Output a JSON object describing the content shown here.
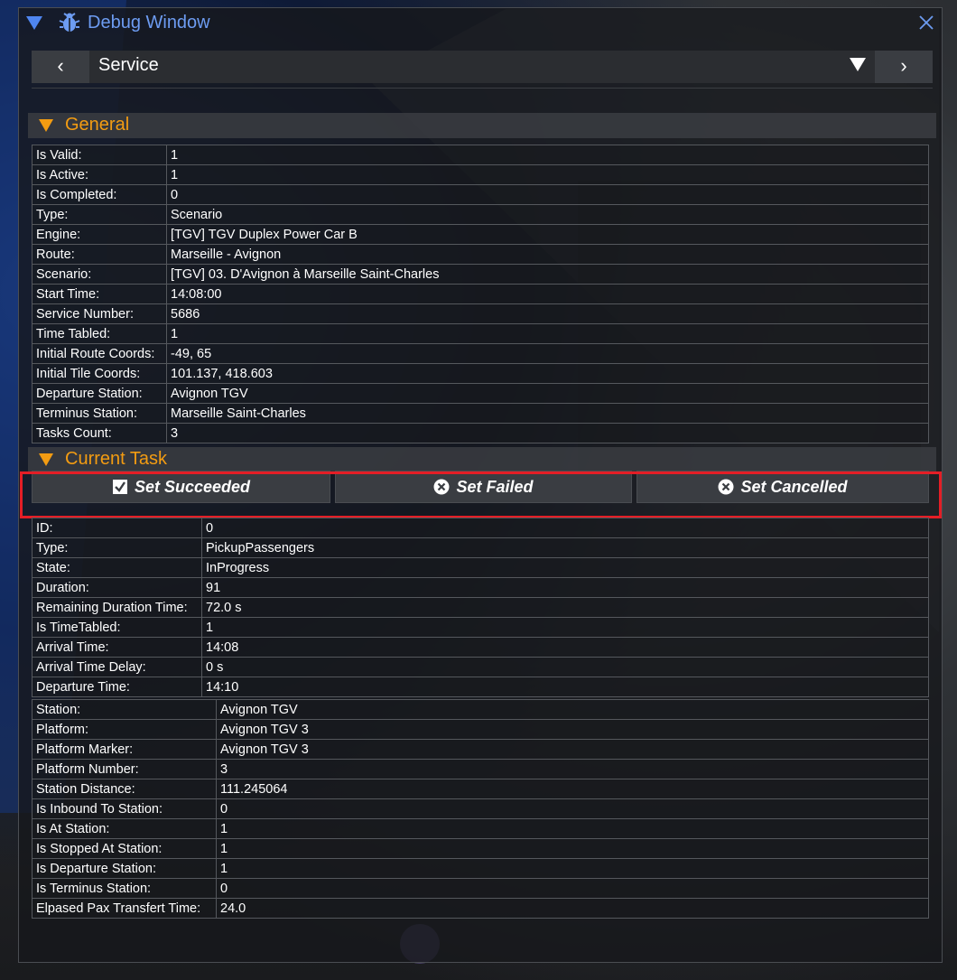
{
  "window": {
    "title": "Debug Window"
  },
  "nav": {
    "prev_label": "‹",
    "next_label": "›",
    "title": "Service"
  },
  "general": {
    "title": "General",
    "rows": [
      {
        "k": "Is Valid:",
        "v": "1"
      },
      {
        "k": "Is Active:",
        "v": "1"
      },
      {
        "k": "Is Completed:",
        "v": "0"
      },
      {
        "k": "Type:",
        "v": "Scenario"
      },
      {
        "k": "Engine:",
        "v": "[TGV] TGV Duplex Power Car B"
      },
      {
        "k": "Route:",
        "v": "Marseille - Avignon"
      },
      {
        "k": "Scenario:",
        "v": "[TGV] 03. D'Avignon à Marseille Saint-Charles"
      },
      {
        "k": "Start Time:",
        "v": "14:08:00"
      },
      {
        "k": "Service Number:",
        "v": "5686"
      },
      {
        "k": "Time Tabled:",
        "v": "1"
      },
      {
        "k": "Initial Route Coords:",
        "v": "-49, 65"
      },
      {
        "k": "Initial Tile Coords:",
        "v": "101.137, 418.603"
      },
      {
        "k": "Departure Station:",
        "v": "Avignon TGV"
      },
      {
        "k": "Terminus Station:",
        "v": "Marseille Saint-Charles"
      },
      {
        "k": "Tasks Count:",
        "v": "3"
      }
    ]
  },
  "current_task": {
    "title": "Current Task",
    "buttons": {
      "succeeded": "Set Succeeded",
      "failed": "Set Failed",
      "cancelled": "Set Cancelled"
    },
    "rows": [
      {
        "k": "ID:",
        "v": "0"
      },
      {
        "k": "Type:",
        "v": "PickupPassengers"
      },
      {
        "k": "State:",
        "v": "InProgress"
      },
      {
        "k": "Duration:",
        "v": "91"
      },
      {
        "k": "Remaining Duration Time:",
        "v": "72.0 s"
      },
      {
        "k": "Is TimeTabled:",
        "v": "1"
      },
      {
        "k": "Arrival Time:",
        "v": "14:08"
      },
      {
        "k": "Arrival Time Delay:",
        "v": "0 s"
      },
      {
        "k": "Departure Time:",
        "v": "14:10"
      }
    ],
    "station_rows": [
      {
        "k": "Station:",
        "v": "Avignon TGV"
      },
      {
        "k": "Platform:",
        "v": "Avignon TGV 3"
      },
      {
        "k": "Platform Marker:",
        "v": "Avignon TGV 3"
      },
      {
        "k": "Platform Number:",
        "v": "3"
      },
      {
        "k": "Station Distance:",
        "v": "111.245064"
      },
      {
        "k": "Is Inbound To Station:",
        "v": "0"
      },
      {
        "k": "Is At Station:",
        "v": "1"
      },
      {
        "k": "Is Stopped At Station:",
        "v": "1"
      },
      {
        "k": "Is Departure Station:",
        "v": "1"
      },
      {
        "k": "Is Terminus Station:",
        "v": "0"
      },
      {
        "k": "Elpased Pax Transfert Time:",
        "v": "24.0"
      }
    ]
  },
  "colors": {
    "accent": "#f39c12",
    "title_blue": "#6d9cf2",
    "highlight": "#e41e26"
  }
}
